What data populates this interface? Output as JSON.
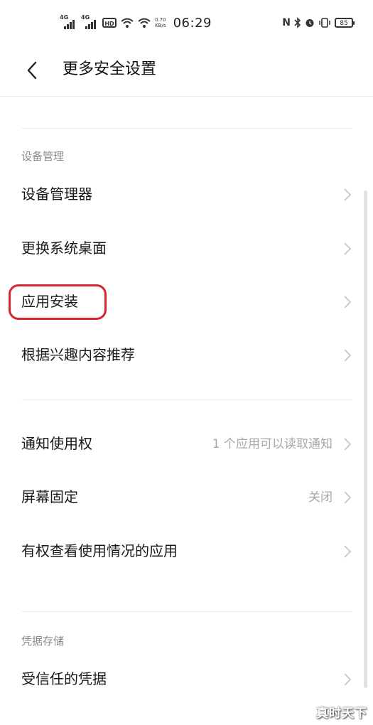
{
  "status_bar": {
    "sim1": "4G",
    "sim2": "4G",
    "hd": "HD",
    "net_speed_value": "0.70",
    "net_speed_unit": "KB/s",
    "time": "06:29",
    "battery": "85"
  },
  "header": {
    "title": "更多安全设置"
  },
  "sections": [
    {
      "label": "设备管理",
      "items": [
        {
          "label": "设备管理器",
          "value": ""
        },
        {
          "label": "更换系统桌面",
          "value": ""
        },
        {
          "label": "应用安装",
          "value": ""
        },
        {
          "label": "根据兴趣内容推荐",
          "value": ""
        }
      ]
    },
    {
      "label": "",
      "items": [
        {
          "label": "通知使用权",
          "value": "1 个应用可以读取通知"
        },
        {
          "label": "屏幕固定",
          "value": "关闭"
        },
        {
          "label": "有权查看使用情况的应用",
          "value": ""
        }
      ]
    },
    {
      "label": "凭据存储",
      "items": [
        {
          "label": "受信任的凭据",
          "value": ""
        }
      ]
    }
  ],
  "watermark": "真时天下",
  "colors": {
    "highlight": "#d9232d",
    "secondary_text": "#a8a8a8"
  }
}
